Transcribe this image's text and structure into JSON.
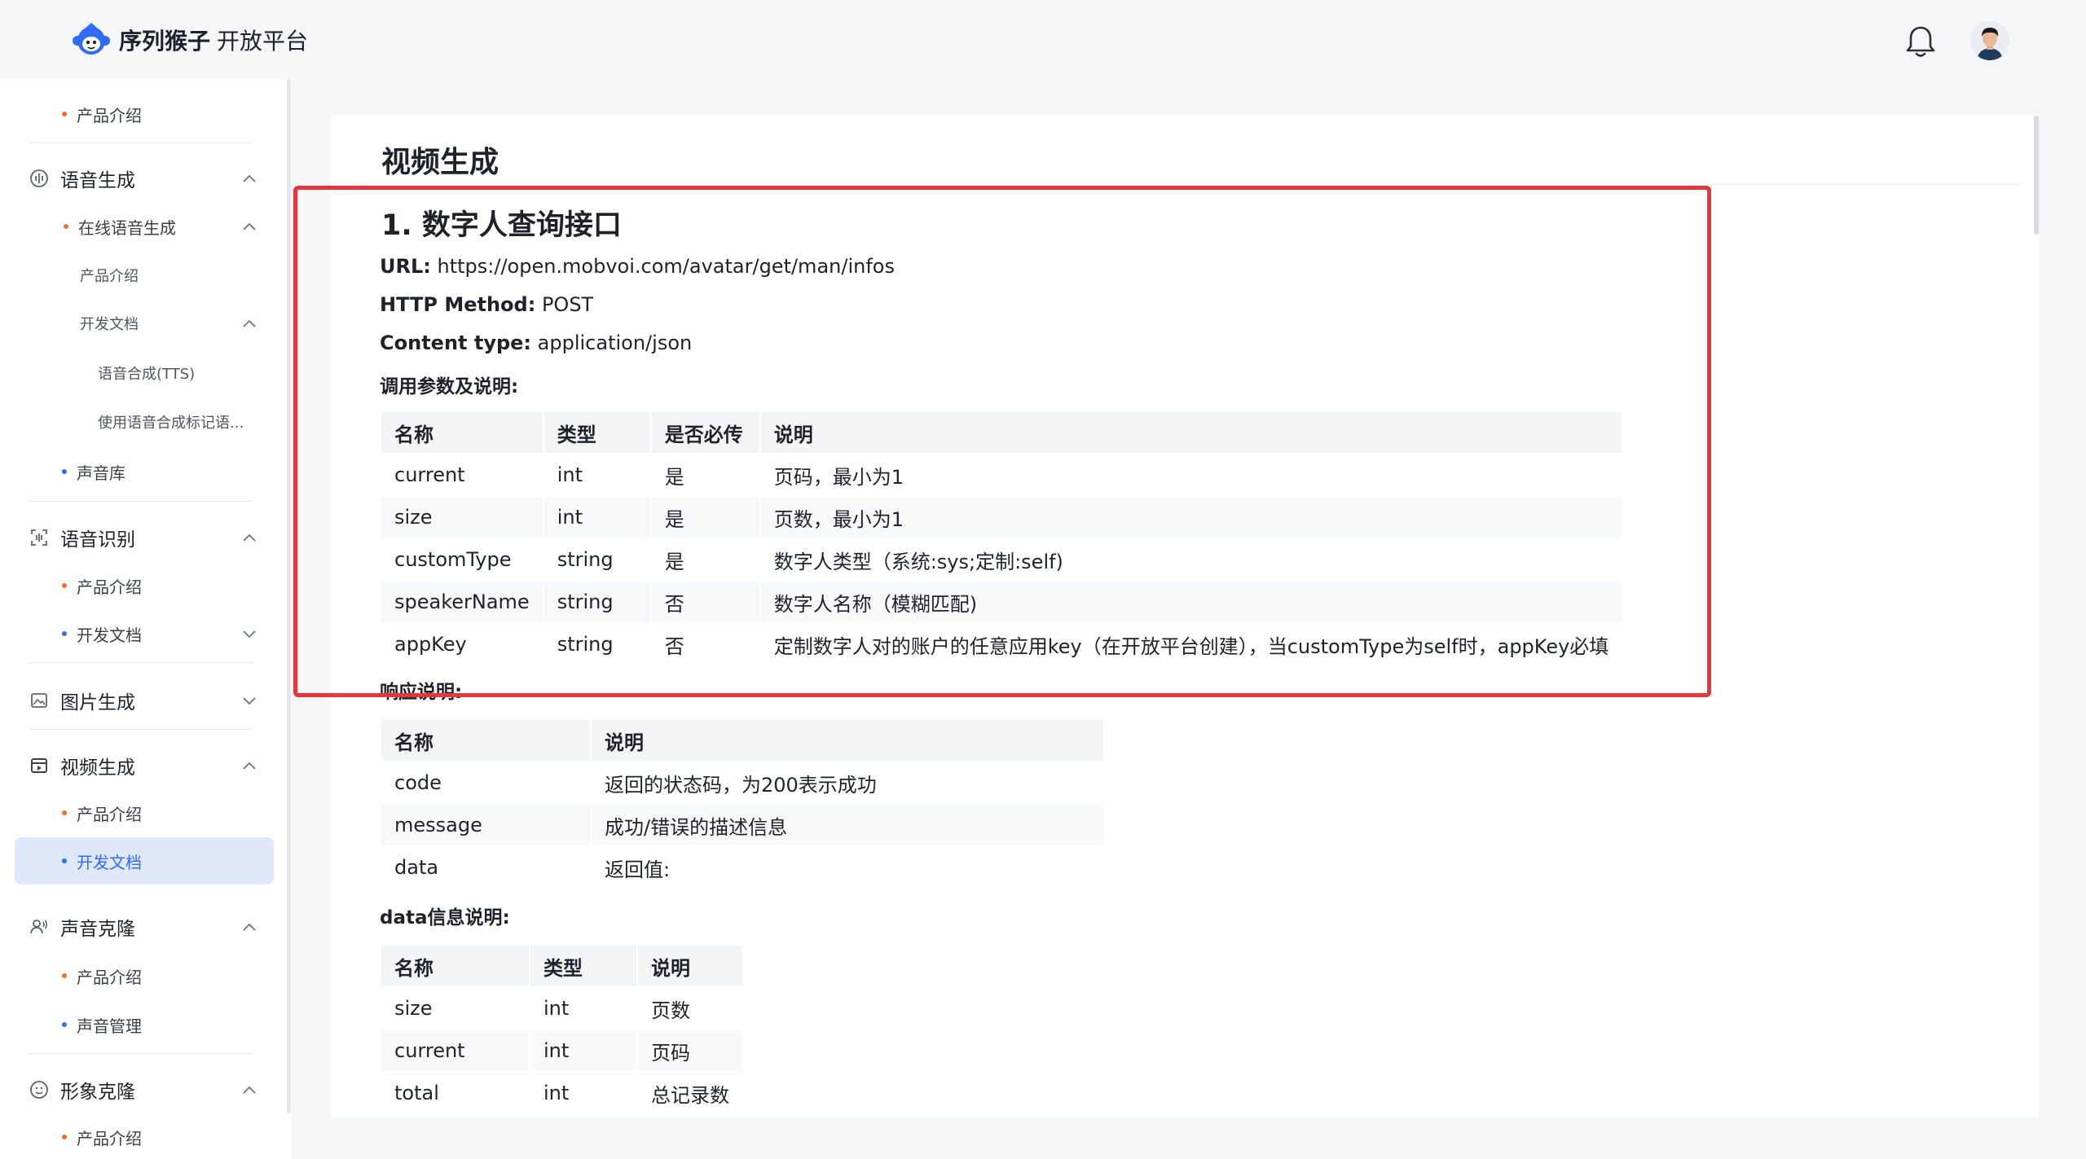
{
  "header": {
    "brand_name": "序列猴子",
    "brand_sub": "开放平台",
    "icons": [
      "monkey-logo",
      "bell-icon",
      "user-avatar"
    ]
  },
  "sidebar": {
    "top_item": "产品介绍",
    "speech_gen": {
      "label": "语音生成",
      "online": "在线语音生成",
      "product_intro": "产品介绍",
      "dev_docs": "开发文档",
      "tts": "语音合成(TTS)",
      "ssml": "使用语音合成标记语...",
      "voice_lib": "声音库"
    },
    "speech_rec": {
      "label": "语音识别",
      "product_intro": "产品介绍",
      "dev_docs": "开发文档"
    },
    "image_gen": {
      "label": "图片生成"
    },
    "video_gen": {
      "label": "视频生成",
      "product_intro": "产品介绍",
      "dev_docs": "开发文档"
    },
    "voice_clone": {
      "label": "声音克隆",
      "product_intro": "产品介绍",
      "voice_manage": "声音管理"
    },
    "avatar_clone": {
      "label": "形象克隆",
      "product_intro": "产品介绍"
    },
    "colors": {
      "orange_dot": "#ff6a2a",
      "blue_dot": "#2f6bff",
      "active_bg": "#dfe8fb"
    }
  },
  "main": {
    "page_title": "视频生成",
    "section_title": "1. 数字人查询接口",
    "url_label": "URL:",
    "url_value": "https://open.mobvoi.com/avatar/get/man/infos",
    "method_label": "HTTP Method:",
    "method_value": "POST",
    "ctype_label": "Content type:",
    "ctype_value": "application/json",
    "params_heading": "调用参数及说明:",
    "params_table": {
      "headers": [
        "名称",
        "类型",
        "是否必传",
        "说明"
      ],
      "rows": [
        [
          "current",
          "int",
          "是",
          "页码，最小为1"
        ],
        [
          "size",
          "int",
          "是",
          "页数，最小为1"
        ],
        [
          "customType",
          "string",
          "是",
          "数字人类型（系统:sys;定制:self)"
        ],
        [
          "speakerName",
          "string",
          "否",
          "数字人名称（模糊匹配)"
        ],
        [
          "appKey",
          "string",
          "否",
          "定制数字人对的账户的任意应用key（在开放平台创建），当customType为self时，appKey必填"
        ]
      ]
    },
    "response_heading": "响应说明:",
    "response_table": {
      "headers": [
        "名称",
        "说明"
      ],
      "rows": [
        [
          "code",
          "返回的状态码，为200表示成功"
        ],
        [
          "message",
          "成功/错误的描述信息"
        ],
        [
          "data",
          "返回值:"
        ]
      ]
    },
    "data_heading": "data信息说明:",
    "data_table": {
      "headers": [
        "名称",
        "类型",
        "说明"
      ],
      "rows": [
        [
          "size",
          "int",
          "页数"
        ],
        [
          "current",
          "int",
          "页码"
        ],
        [
          "total",
          "int",
          "总记录数"
        ]
      ]
    },
    "highlight_color": "#e8353c"
  }
}
